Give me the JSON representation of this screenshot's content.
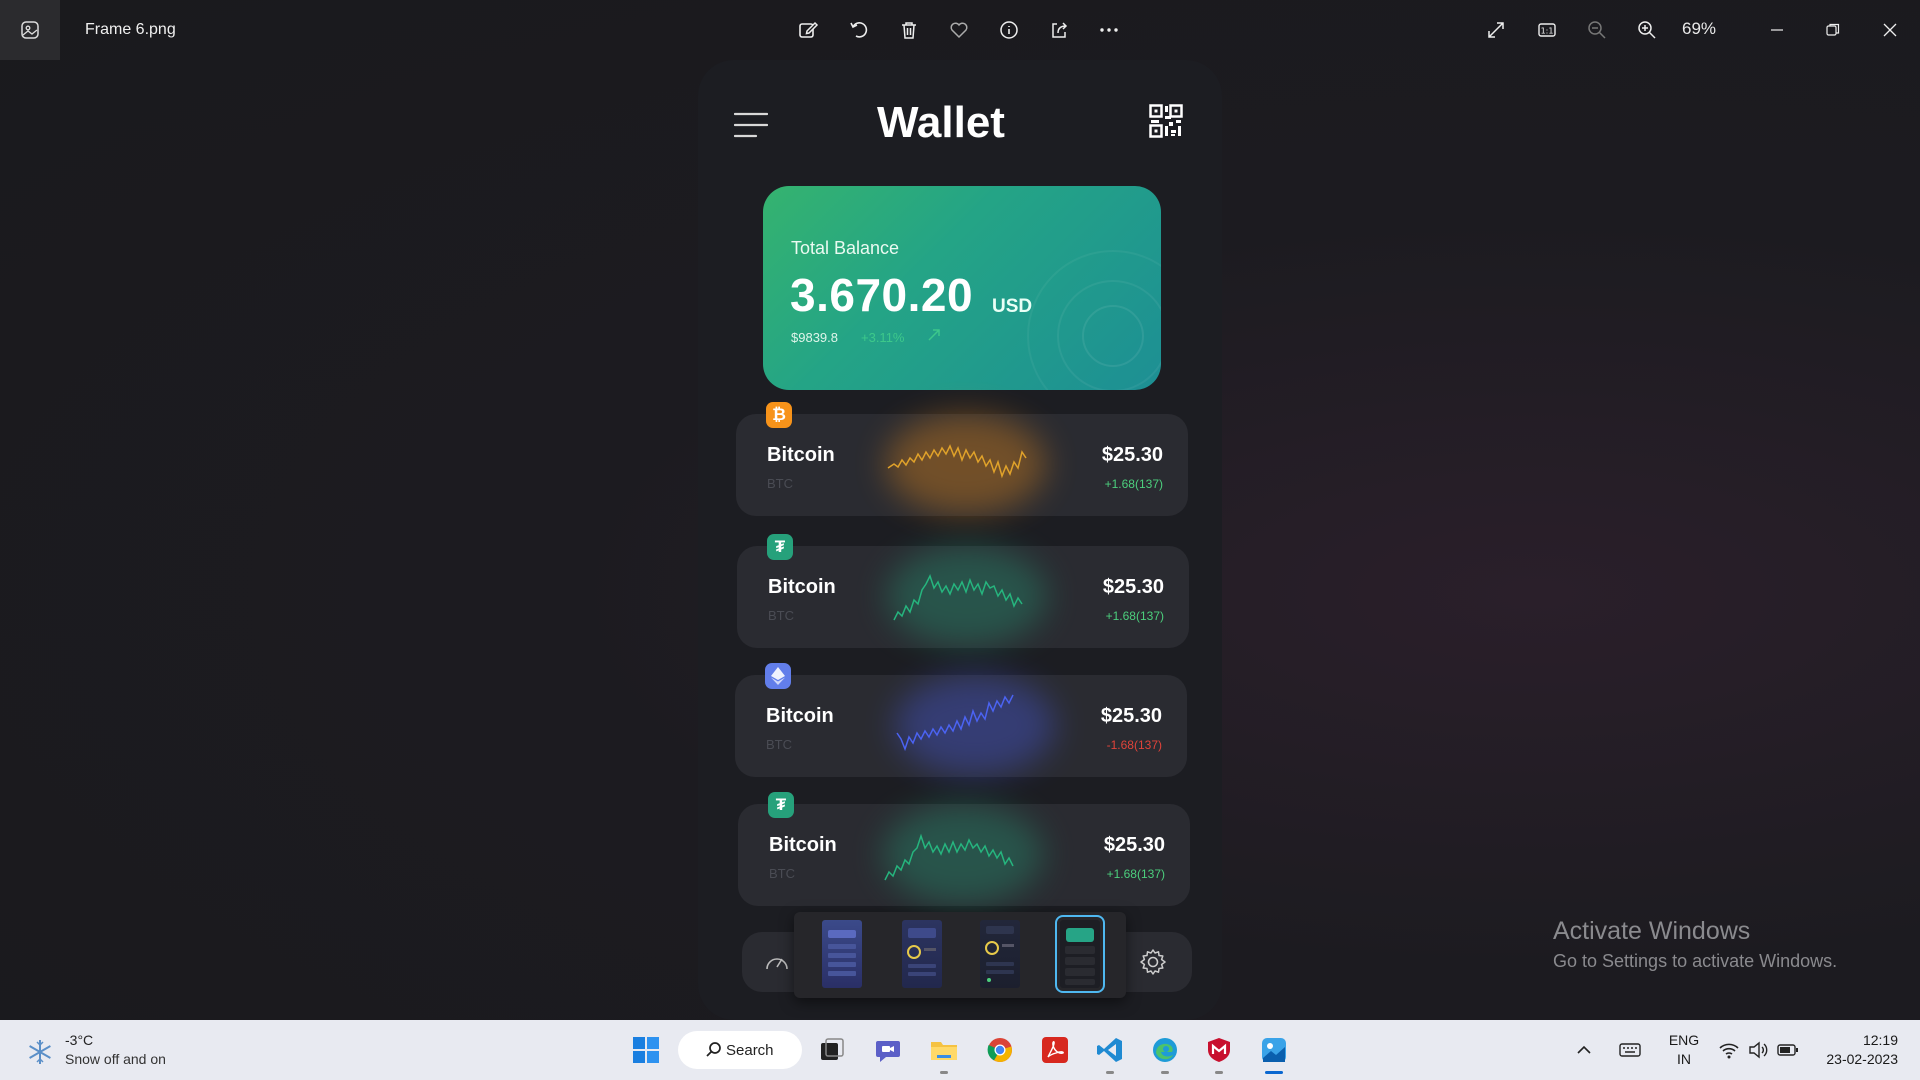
{
  "titlebar": {
    "file_name": "Frame 6.png",
    "zoom": "69%",
    "icons": [
      "photos-app-icon",
      "edit-icon",
      "rotate-icon",
      "delete-icon",
      "favorite-icon",
      "info-icon",
      "share-icon",
      "more-icon",
      "fullscreen-icon",
      "actual-size-icon",
      "zoom-out-icon",
      "zoom-in-icon",
      "minimize-icon",
      "restore-icon",
      "close-icon"
    ]
  },
  "wallet": {
    "title": "Wallet",
    "balance": {
      "label": "Total Balance",
      "amount": "3.670.20",
      "currency": "USD",
      "sub_amount": "$9839.8",
      "change": "+3.11%"
    },
    "coins": [
      {
        "name": "Bitcoin",
        "symbol": "BTC",
        "price": "$25.30",
        "change": "+1.68(137)",
        "badge": "bitcoin-icon",
        "color": "#f7931a",
        "change_color": "#4ccf7d"
      },
      {
        "name": "Bitcoin",
        "symbol": "BTC",
        "price": "$25.30",
        "change": "+1.68(137)",
        "badge": "tether-icon",
        "color": "#26a17b",
        "change_color": "#4ccf7d"
      },
      {
        "name": "Bitcoin",
        "symbol": "BTC",
        "price": "$25.30",
        "change": "-1.68(137)",
        "badge": "ethereum-icon",
        "color": "#627eea",
        "change_color": "#e0433a"
      },
      {
        "name": "Bitcoin",
        "symbol": "BTC",
        "price": "$25.30",
        "change": "+1.68(137)",
        "badge": "tether-icon",
        "color": "#26a17b",
        "change_color": "#4ccf7d"
      }
    ]
  },
  "watermark": {
    "title": "Activate Windows",
    "subtitle": "Go to Settings to activate Windows."
  },
  "taskbar": {
    "weather_temp": "-3°C",
    "weather_desc": "Snow off and on",
    "search_label": "Search",
    "language_line1": "ENG",
    "language_line2": "IN",
    "time": "12:19",
    "date": "23-02-2023"
  }
}
